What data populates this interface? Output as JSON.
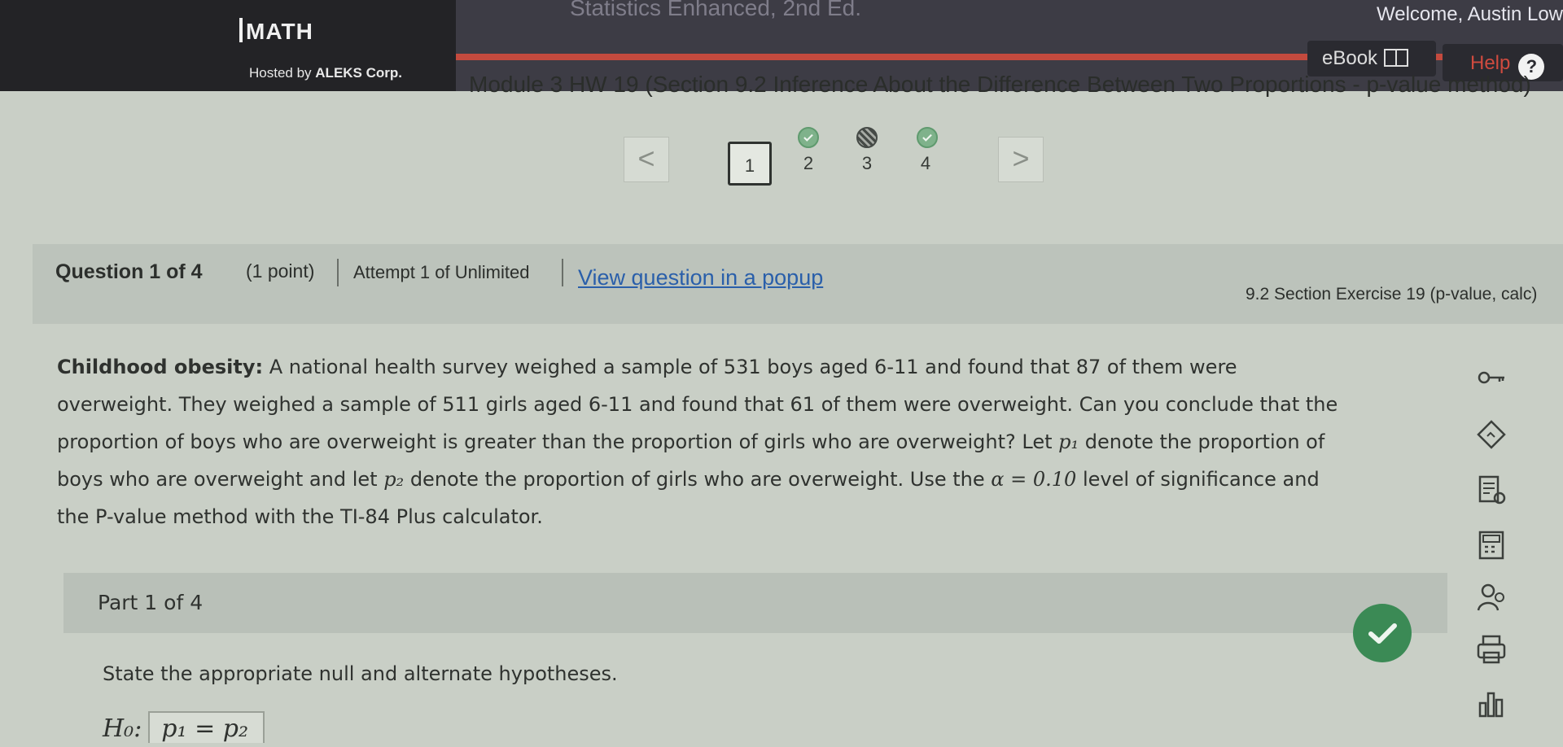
{
  "header": {
    "brand": "MATH",
    "hosted_prefix": "Hosted by",
    "hosted_by": "ALEKS Corp.",
    "course_title": "Statistics Enhanced, 2nd Ed.",
    "welcome": "Welcome, Austin Low",
    "ebook_label": "eBook",
    "help_label": "Help",
    "help_glyph": "?"
  },
  "module_title": "Module 3 HW 19 (Section 9.2 Inference About the Difference Between Two Proportions - p-value method)",
  "navigation": {
    "prev": "<",
    "next": ">",
    "questions": [
      {
        "label": "1",
        "status": "none",
        "active": true
      },
      {
        "label": "2",
        "status": "done",
        "active": false
      },
      {
        "label": "3",
        "status": "partial",
        "active": false
      },
      {
        "label": "4",
        "status": "done",
        "active": false
      }
    ]
  },
  "question": {
    "label": "Question 1 of 4",
    "points": "(1 point)",
    "attempt": "Attempt 1 of Unlimited",
    "popup_link": "View question in a popup",
    "exercise": "9.2 Section Exercise 19 (p-value, calc)"
  },
  "problem": {
    "title": "Childhood obesity:",
    "l1": "A national health survey weighed a sample of 531 boys aged 6-11 and found that 87 of them were",
    "l2": "overweight. They weighed a sample of 511 girls aged 6-11 and found that 61 of them were overweight. Can you conclude that the",
    "l3a": "proportion of boys who are overweight is greater than the proportion of girls who are overweight? Let",
    "p1": "p₁",
    "l3b": "denote the proportion of",
    "l4a": "boys who are overweight and let",
    "p2": "p₂",
    "l4b": "denote the proportion of girls who are overweight. Use the",
    "alpha": "α = 0.10",
    "l4c": "level of significance and",
    "l5": "the P-value method with the TI-84 Plus calculator."
  },
  "part": {
    "label": "Part 1 of 4",
    "status": "correct"
  },
  "instruction": "State the appropriate null and alternate hypotheses.",
  "hypothesis": {
    "h0_label": "H₀:",
    "h0_value": "p₁ = p₂"
  },
  "tools": [
    "key-icon",
    "hint-icon",
    "tutorial-icon",
    "calculator-icon",
    "help-person-icon",
    "print-icon",
    "chart-icon"
  ],
  "colors": {
    "header_bg": "#3d3c45",
    "header_left_bg": "#232326",
    "accent_red": "#c44a3e",
    "link": "#2a5faa",
    "success": "#3b8a55"
  }
}
